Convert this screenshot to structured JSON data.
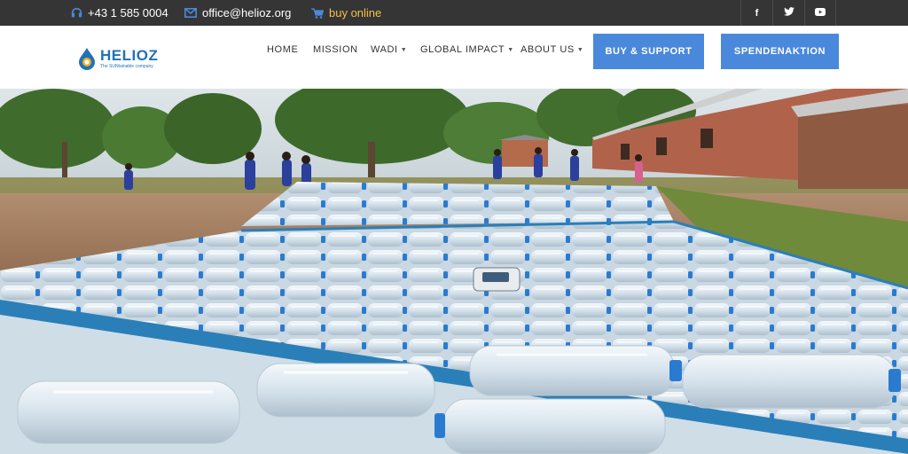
{
  "topbar": {
    "phone": "+43 1 585 0004",
    "email": "office@helioz.org",
    "buy_online": "buy online",
    "social": [
      {
        "icon": "facebook-icon",
        "glyph": "f"
      },
      {
        "icon": "twitter-icon",
        "glyph": "t"
      },
      {
        "icon": "youtube-icon",
        "glyph": "▶"
      }
    ]
  },
  "header": {
    "logo_name": "HELIOZ",
    "logo_tagline": "The SUNtainable company",
    "nav": [
      {
        "label": "HOME",
        "dropdown": false
      },
      {
        "label": "MISSION",
        "dropdown": false
      },
      {
        "label": "WADI",
        "dropdown": true
      },
      {
        "label": "GLOBAL IMPACT",
        "dropdown": true
      },
      {
        "label": "ABOUT US",
        "dropdown": true
      }
    ],
    "buttons": {
      "buy_support": "BUY & SUPPORT",
      "spendenaktion": "SPENDENAKTION"
    }
  },
  "colors": {
    "topbar_bg": "#353535",
    "accent_blue": "#4a88db",
    "buy_online": "#f5c04a",
    "brand": "#1f72b8"
  }
}
